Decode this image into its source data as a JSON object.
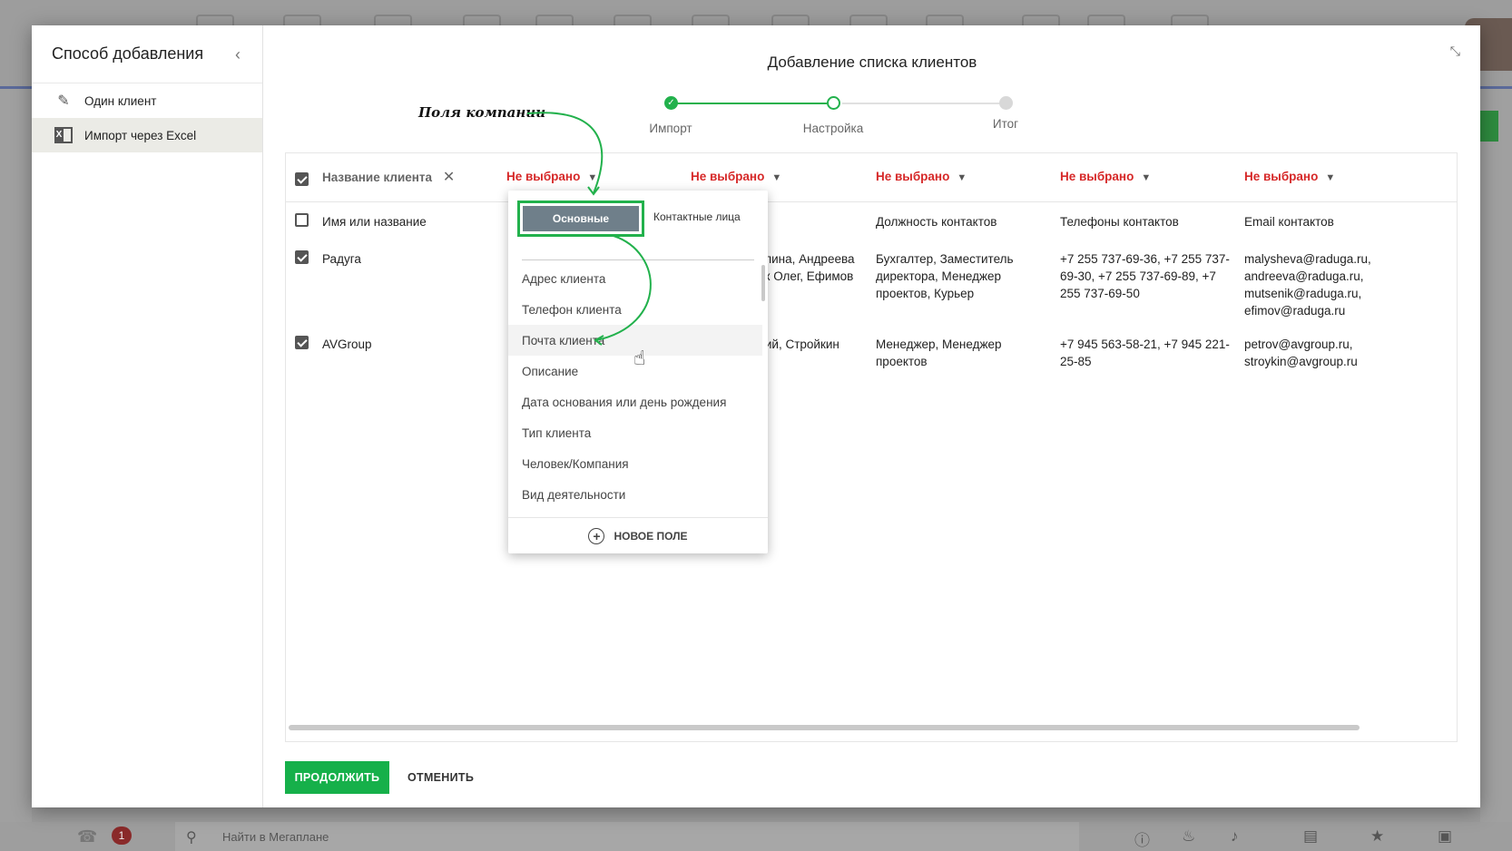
{
  "background": {
    "search_icon": "search-icon",
    "search_text": "Найти в Мегаплане",
    "notifications_badge": "1"
  },
  "sidebar": {
    "title": "Способ добавления",
    "items": [
      {
        "label": "Один клиент",
        "icon": "pencil-icon"
      },
      {
        "label": "Импорт через Excel",
        "icon": "excel-icon",
        "active": true
      }
    ]
  },
  "dialog": {
    "title": "Добавление списка клиентов",
    "steps": [
      {
        "label": "Импорт",
        "state": "done"
      },
      {
        "label": "Настройка",
        "state": "current"
      },
      {
        "label": "Итог",
        "state": "todo"
      }
    ],
    "annotation": "Поля компании"
  },
  "table": {
    "columns": [
      {
        "label": "Название клиента",
        "selected": true
      },
      {
        "label": "Не выбрано"
      },
      {
        "label": "Не выбрано"
      },
      {
        "label": "Не выбрано"
      },
      {
        "label": "Не выбрано"
      },
      {
        "label": "Не выбрано"
      }
    ],
    "rows": [
      {
        "checked": false,
        "cells": [
          "Имя или название",
          "",
          "",
          "Должность контактов",
          "Телефоны контактов",
          "Email контактов"
        ]
      },
      {
        "checked": true,
        "cells": [
          "Радуга",
          "",
          "олина, Андреева ик Олег, Ефимов",
          "Бухгалтер, Заместитель директора, Менеджер проектов, Курьер",
          "+7 255 737-69-36, +7 255 737-69-30, +7 255 737-69-89, +7 255 737-69-50",
          "malysheva@raduga.ru, andreeva@raduga.ru, mutsenik@raduga.ru, efimov@raduga.ru"
        ]
      },
      {
        "checked": true,
        "cells": [
          "AVGroup",
          "",
          "дий, Стройкин",
          "Менеджер, Менеджер проектов",
          "+7 945 563-58-21, +7 945 221-25-85",
          "petrov@avgroup.ru, stroykin@avgroup.ru"
        ]
      }
    ]
  },
  "dropdown": {
    "tabs": [
      "Основные",
      "Контактные лица"
    ],
    "items": [
      "Адрес клиента",
      "Телефон клиента",
      "Почта клиента",
      "Описание",
      "Дата основания или день рождения",
      "Тип клиента",
      "Человек/Компания",
      "Вид деятельности"
    ],
    "hover_index": 2,
    "new_field": "НОВОЕ ПОЛЕ"
  },
  "buttons": {
    "continue": "ПРОДОЛЖИТЬ",
    "cancel": "ОТМЕНИТЬ"
  },
  "colors": {
    "accent": "#22b14c",
    "unselected_header": "#d62828",
    "tab_active": "#6f7f8a"
  }
}
